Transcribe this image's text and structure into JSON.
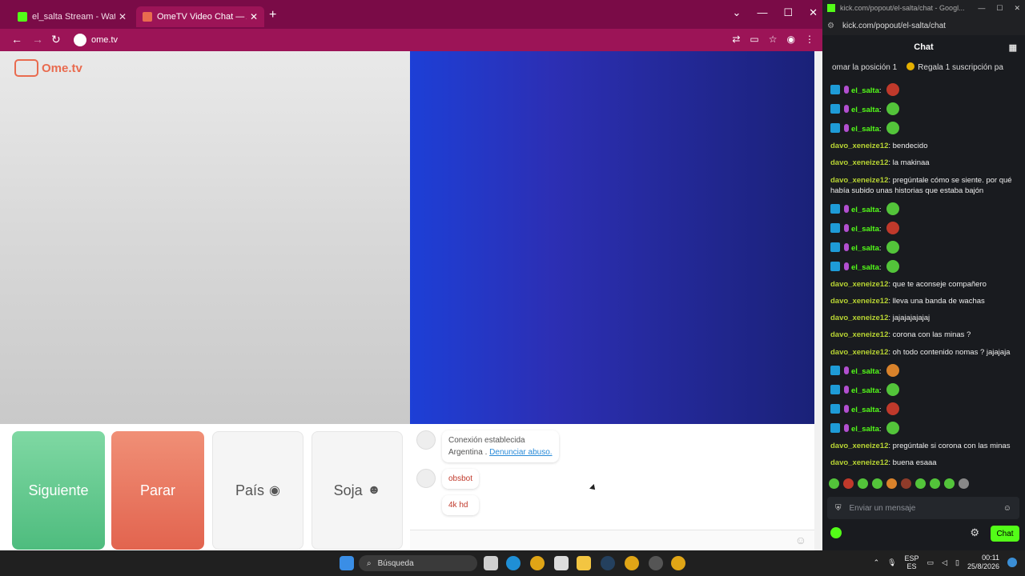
{
  "browser": {
    "tabs": [
      {
        "title": "el_salta Stream - Watch Live on Kick",
        "favicon_color": "#53fc18"
      },
      {
        "title": "OmeTV Video Chat — Alternative",
        "favicon_color": "#e96b4f"
      }
    ],
    "url": "ome.tv"
  },
  "ometv": {
    "logo": "Ome.tv",
    "buttons": {
      "next": "Siguiente",
      "stop": "Parar",
      "country": "País",
      "gender": "Soja"
    },
    "system_message": {
      "line1": "Conexión establecida",
      "country": "Argentina .",
      "report": "Denunciar abuso."
    },
    "user_messages": [
      "obsbot",
      "4k hd"
    ]
  },
  "kick": {
    "titlebar": "kick.com/popout/el-salta/chat - Googl...",
    "url": "kick.com/popout/el-salta/chat",
    "header": "Chat",
    "pinned": [
      "omar la posición 1",
      "Regala 1 suscripción pa"
    ],
    "messages": [
      {
        "user": "el_salta",
        "text": "",
        "emote": "#c0392b",
        "badges": true
      },
      {
        "user": "el_salta",
        "text": "",
        "emote": "#53c43a",
        "badges": true
      },
      {
        "user": "el_salta",
        "text": "",
        "emote": "#53c43a",
        "badges": true
      },
      {
        "user": "davo_xeneize12",
        "text": "bendecido"
      },
      {
        "user": "davo_xeneize12",
        "text": "la makinaa"
      },
      {
        "user": "davo_xeneize12",
        "text": "pregúntale cómo se siente. por qué había subido unas historias que estaba bajón"
      },
      {
        "user": "el_salta",
        "text": "",
        "emote": "#53c43a",
        "badges": true
      },
      {
        "user": "el_salta",
        "text": "",
        "emote": "#c0392b",
        "badges": true
      },
      {
        "user": "el_salta",
        "text": "",
        "emote": "#53c43a",
        "badges": true
      },
      {
        "user": "el_salta",
        "text": "",
        "emote": "#53c43a",
        "badges": true
      },
      {
        "user": "davo_xeneize12",
        "text": "que te aconseje compañero"
      },
      {
        "user": "davo_xeneize12",
        "text": "lleva una banda de wachas"
      },
      {
        "user": "davo_xeneize12",
        "text": "jajajajajajaj"
      },
      {
        "user": "davo_xeneize12",
        "text": "corona con las minas ?"
      },
      {
        "user": "davo_xeneize12",
        "text": "oh todo contenido nomas ? jajajaja"
      },
      {
        "user": "el_salta",
        "text": "",
        "emote": "#d9822b",
        "badges": true
      },
      {
        "user": "el_salta",
        "text": "",
        "emote": "#53c43a",
        "badges": true
      },
      {
        "user": "el_salta",
        "text": "",
        "emote": "#c0392b",
        "badges": true
      },
      {
        "user": "el_salta",
        "text": "",
        "emote": "#53c43a",
        "badges": true
      },
      {
        "user": "davo_xeneize12",
        "text": "pregúntale si corona con las minas"
      },
      {
        "user": "davo_xeneize12",
        "text": "buena esaaa"
      }
    ],
    "emote_bar_colors": [
      "#53c43a",
      "#c0392b",
      "#53c43a",
      "#53c43a",
      "#d9822b",
      "#8e3b2a",
      "#53c43a",
      "#53c43a",
      "#53c43a",
      "#888888"
    ],
    "input_placeholder": "Enviar un mensaje",
    "send_label": "Chat"
  },
  "taskbar": {
    "search": "Búsqueda",
    "lang": "ESP",
    "lang2": "ES",
    "time": "00:11",
    "date": "25/8/2026"
  },
  "colors": {
    "kick_green": "#53fc18",
    "davo_name": "#b8d433",
    "salta_name": "#53fc18",
    "browser_frame": "#7a0b47"
  }
}
